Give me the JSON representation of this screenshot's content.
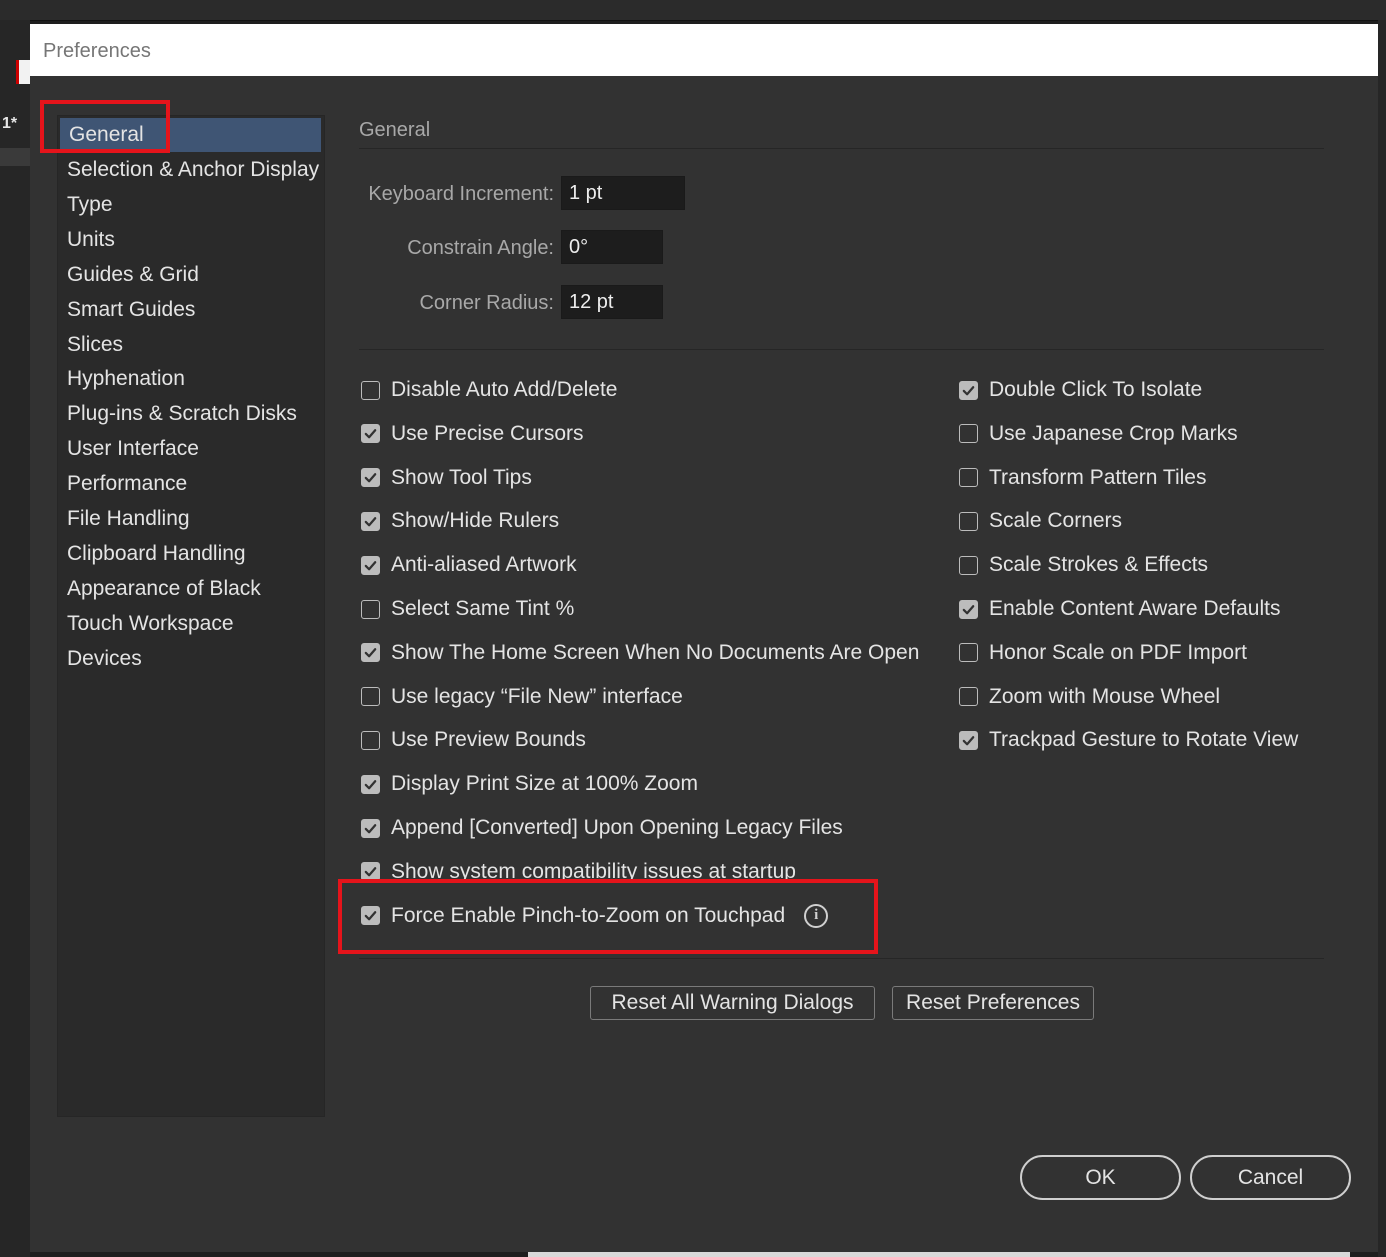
{
  "app": {
    "tab_marker": "1*"
  },
  "dialog": {
    "title": "Preferences"
  },
  "sidebar": {
    "items": [
      {
        "label": "General",
        "selected": true
      },
      {
        "label": "Selection & Anchor Display",
        "selected": false
      },
      {
        "label": "Type",
        "selected": false
      },
      {
        "label": "Units",
        "selected": false
      },
      {
        "label": "Guides & Grid",
        "selected": false
      },
      {
        "label": "Smart Guides",
        "selected": false
      },
      {
        "label": "Slices",
        "selected": false
      },
      {
        "label": "Hyphenation",
        "selected": false
      },
      {
        "label": "Plug-ins & Scratch Disks",
        "selected": false
      },
      {
        "label": "User Interface",
        "selected": false
      },
      {
        "label": "Performance",
        "selected": false
      },
      {
        "label": "File Handling",
        "selected": false
      },
      {
        "label": "Clipboard Handling",
        "selected": false
      },
      {
        "label": "Appearance of Black",
        "selected": false
      },
      {
        "label": "Touch Workspace",
        "selected": false
      },
      {
        "label": "Devices",
        "selected": false
      }
    ]
  },
  "general": {
    "section_title": "General",
    "keyboard_increment": {
      "label": "Keyboard Increment:",
      "value": "1 pt"
    },
    "constrain_angle": {
      "label": "Constrain Angle:",
      "value": "0°"
    },
    "corner_radius": {
      "label": "Corner Radius:",
      "value": "12 pt"
    },
    "left_options": [
      {
        "label": "Disable Auto Add/Delete",
        "checked": false
      },
      {
        "label": "Use Precise Cursors",
        "checked": true
      },
      {
        "label": "Show Tool Tips",
        "checked": true
      },
      {
        "label": "Show/Hide Rulers",
        "checked": true
      },
      {
        "label": "Anti-aliased Artwork",
        "checked": true
      },
      {
        "label": "Select Same Tint %",
        "checked": false
      },
      {
        "label": "Show The Home Screen When No Documents Are Open",
        "checked": true
      },
      {
        "label": "Use legacy “File New” interface",
        "checked": false
      },
      {
        "label": "Use Preview Bounds",
        "checked": false
      },
      {
        "label": "Display Print Size at 100% Zoom",
        "checked": true
      },
      {
        "label": "Append [Converted] Upon Opening Legacy Files",
        "checked": true
      },
      {
        "label": "Show system compatibility issues at startup",
        "checked": true
      },
      {
        "label": "Force Enable Pinch-to-Zoom on Touchpad",
        "checked": true
      }
    ],
    "right_options": [
      {
        "label": "Double Click To Isolate",
        "checked": true
      },
      {
        "label": "Use Japanese Crop Marks",
        "checked": false
      },
      {
        "label": "Transform Pattern Tiles",
        "checked": false
      },
      {
        "label": "Scale Corners",
        "checked": false
      },
      {
        "label": "Scale Strokes & Effects",
        "checked": false
      },
      {
        "label": "Enable Content Aware Defaults",
        "checked": true
      },
      {
        "label": "Honor Scale on PDF Import",
        "checked": false
      },
      {
        "label": "Zoom with Mouse Wheel",
        "checked": false
      },
      {
        "label": "Trackpad Gesture to Rotate View",
        "checked": true
      }
    ],
    "info_icon_glyph": "i",
    "reset_warnings_label": "Reset All Warning Dialogs",
    "reset_prefs_label": "Reset Preferences"
  },
  "footer": {
    "ok_label": "OK",
    "cancel_label": "Cancel"
  },
  "colors": {
    "highlight": "#e5141b",
    "selection": "#3f5574",
    "dialog_bg": "#323232"
  }
}
